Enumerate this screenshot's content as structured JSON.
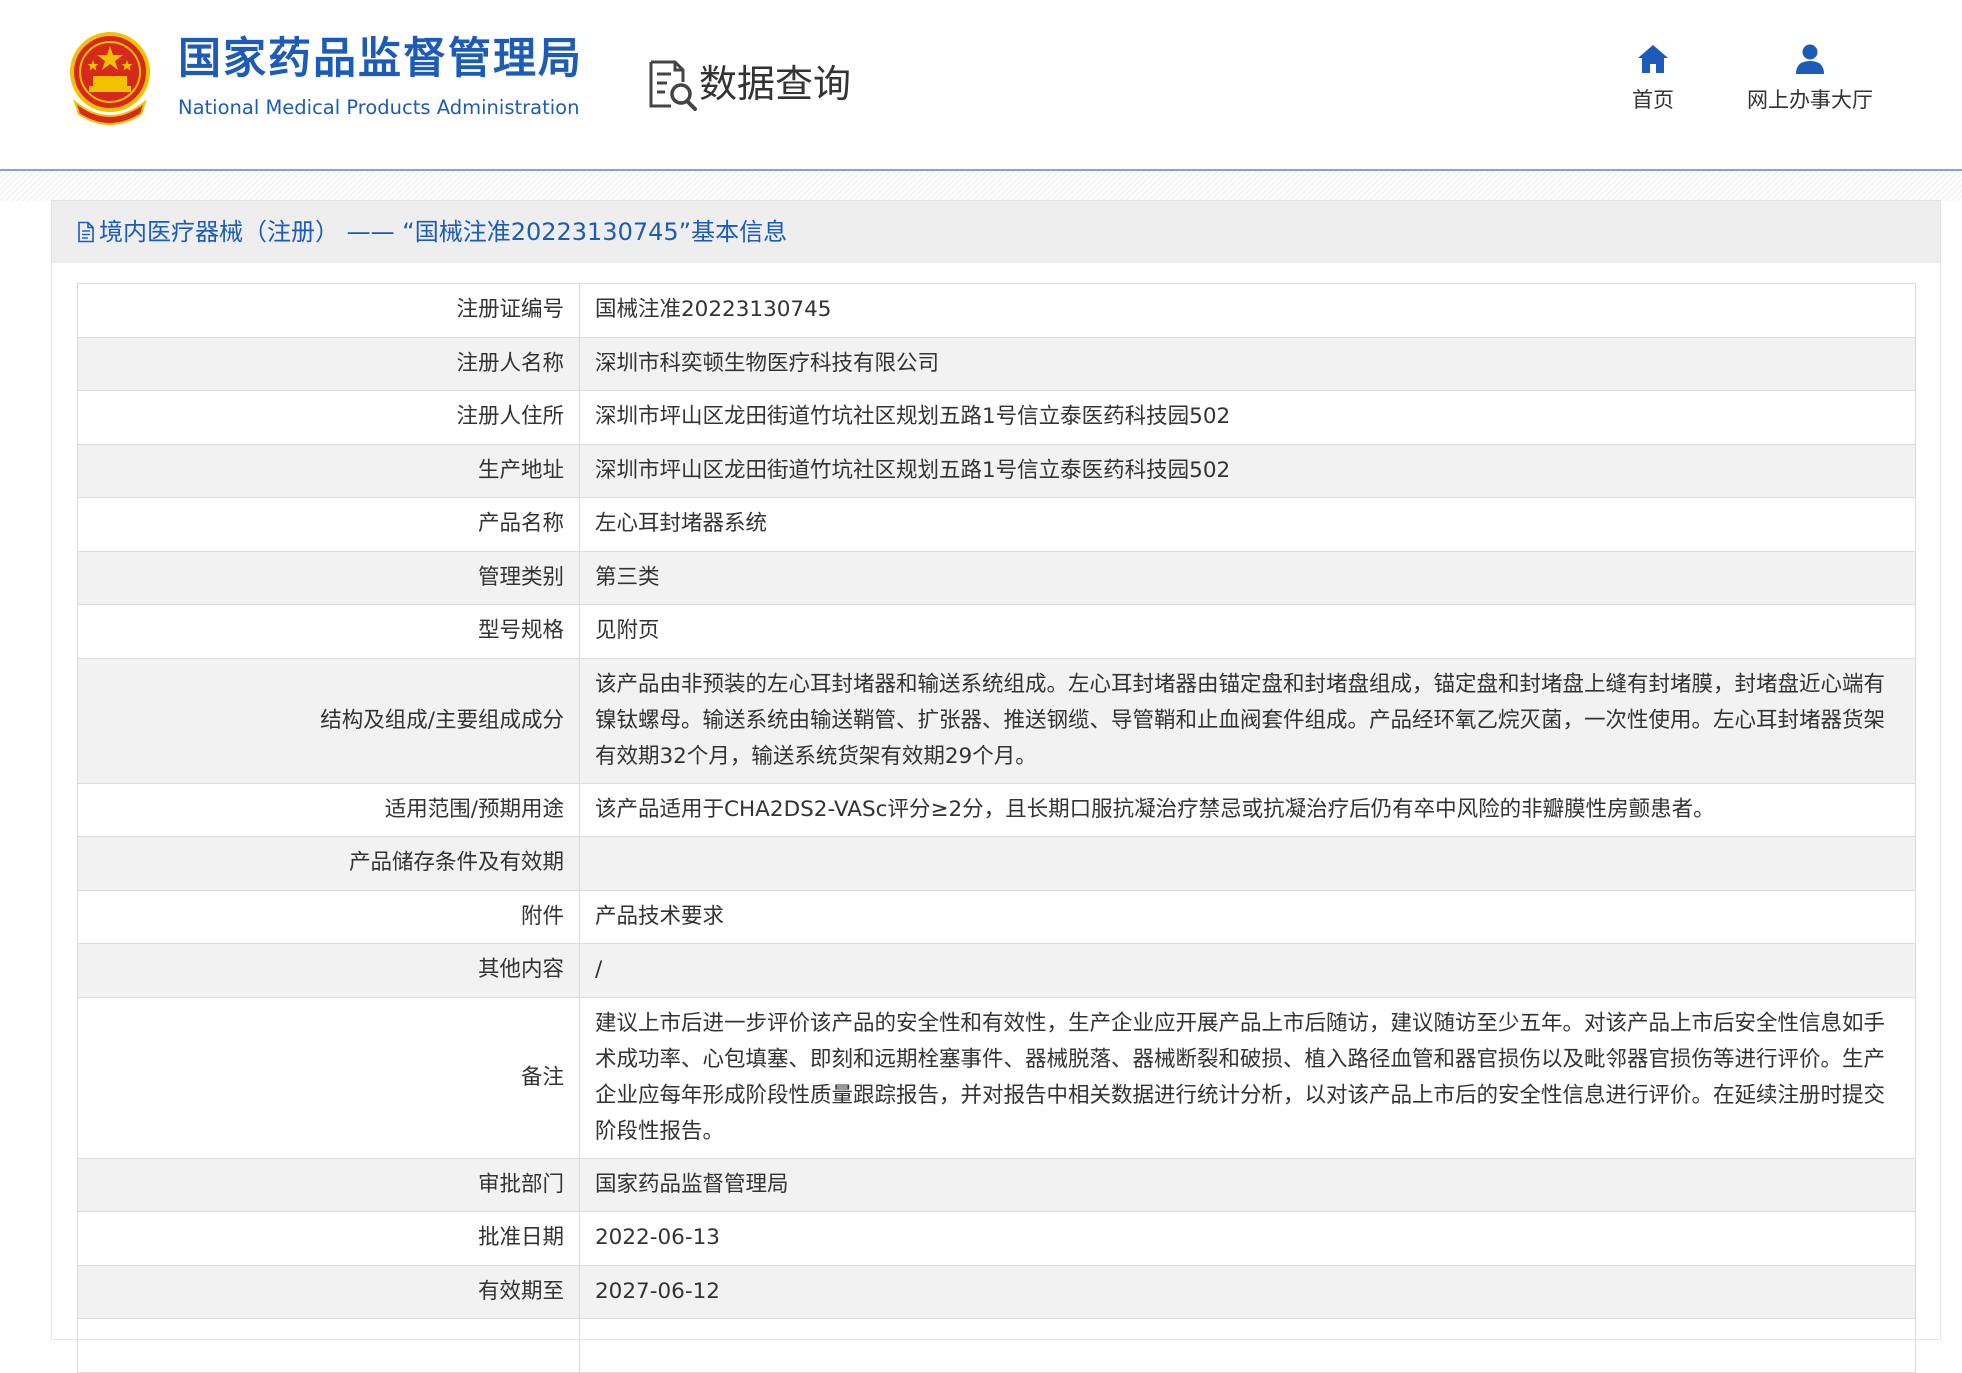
{
  "header": {
    "brand_cn": "国家药品监督管理局",
    "brand_en": "National Medical Products Administration",
    "data_query": "数据查询",
    "nav": [
      {
        "label": "首页",
        "icon": "home-icon"
      },
      {
        "label": "网上办事大厅",
        "icon": "user-icon"
      }
    ]
  },
  "panel": {
    "title": "境内医疗器械（注册） —— “国械注准20223130745”基本信息"
  },
  "rows": [
    {
      "label": "注册证编号",
      "value": "国械注准20223130745"
    },
    {
      "label": "注册人名称",
      "value": "深圳市科奕顿生物医疗科技有限公司"
    },
    {
      "label": "注册人住所",
      "value": "深圳市坪山区龙田街道竹坑社区规划五路1号信立泰医药科技园502"
    },
    {
      "label": "生产地址",
      "value": "深圳市坪山区龙田街道竹坑社区规划五路1号信立泰医药科技园502"
    },
    {
      "label": "产品名称",
      "value": "左心耳封堵器系统"
    },
    {
      "label": "管理类别",
      "value": "第三类"
    },
    {
      "label": "型号规格",
      "value": "见附页"
    },
    {
      "label": "结构及组成/主要组成成分",
      "value": "该产品由非预装的左心耳封堵器和输送系统组成。左心耳封堵器由锚定盘和封堵盘组成，锚定盘和封堵盘上缝有封堵膜，封堵盘近心端有镍钛螺母。输送系统由输送鞘管、扩张器、推送钢缆、导管鞘和止血阀套件组成。产品经环氧乙烷灭菌，一次性使用。左心耳封堵器货架有效期32个月，输送系统货架有效期29个月。"
    },
    {
      "label": "适用范围/预期用途",
      "value": "该产品适用于CHA2DS2-VASc评分≥2分，且长期口服抗凝治疗禁忌或抗凝治疗后仍有卒中风险的非瓣膜性房颤患者。"
    },
    {
      "label": "产品储存条件及有效期",
      "value": ""
    },
    {
      "label": "附件",
      "value": "产品技术要求"
    },
    {
      "label": "其他内容",
      "value": "/"
    },
    {
      "label": "备注",
      "value": "建议上市后进一步评价该产品的安全性和有效性，生产企业应开展产品上市后随访，建议随访至少五年。对该产品上市后安全性信息如手术成功率、心包填塞、即刻和远期栓塞事件、器械脱落、器械断裂和破损、植入路径血管和器官损伤以及毗邻器官损伤等进行评价。生产企业应每年形成阶段性质量跟踪报告，并对报告中相关数据进行统计分析，以对该产品上市后的安全性信息进行评价。在延续注册时提交阶段性报告。"
    },
    {
      "label": "审批部门",
      "value": "国家药品监督管理局"
    },
    {
      "label": "批准日期",
      "value": "2022-06-13"
    },
    {
      "label": "有效期至",
      "value": "2027-06-12"
    },
    {
      "label": "",
      "value": ""
    }
  ],
  "colors": {
    "brand_blue": "#1d5bb8",
    "emblem_red": "#d7281e",
    "emblem_gold": "#f2c200"
  }
}
